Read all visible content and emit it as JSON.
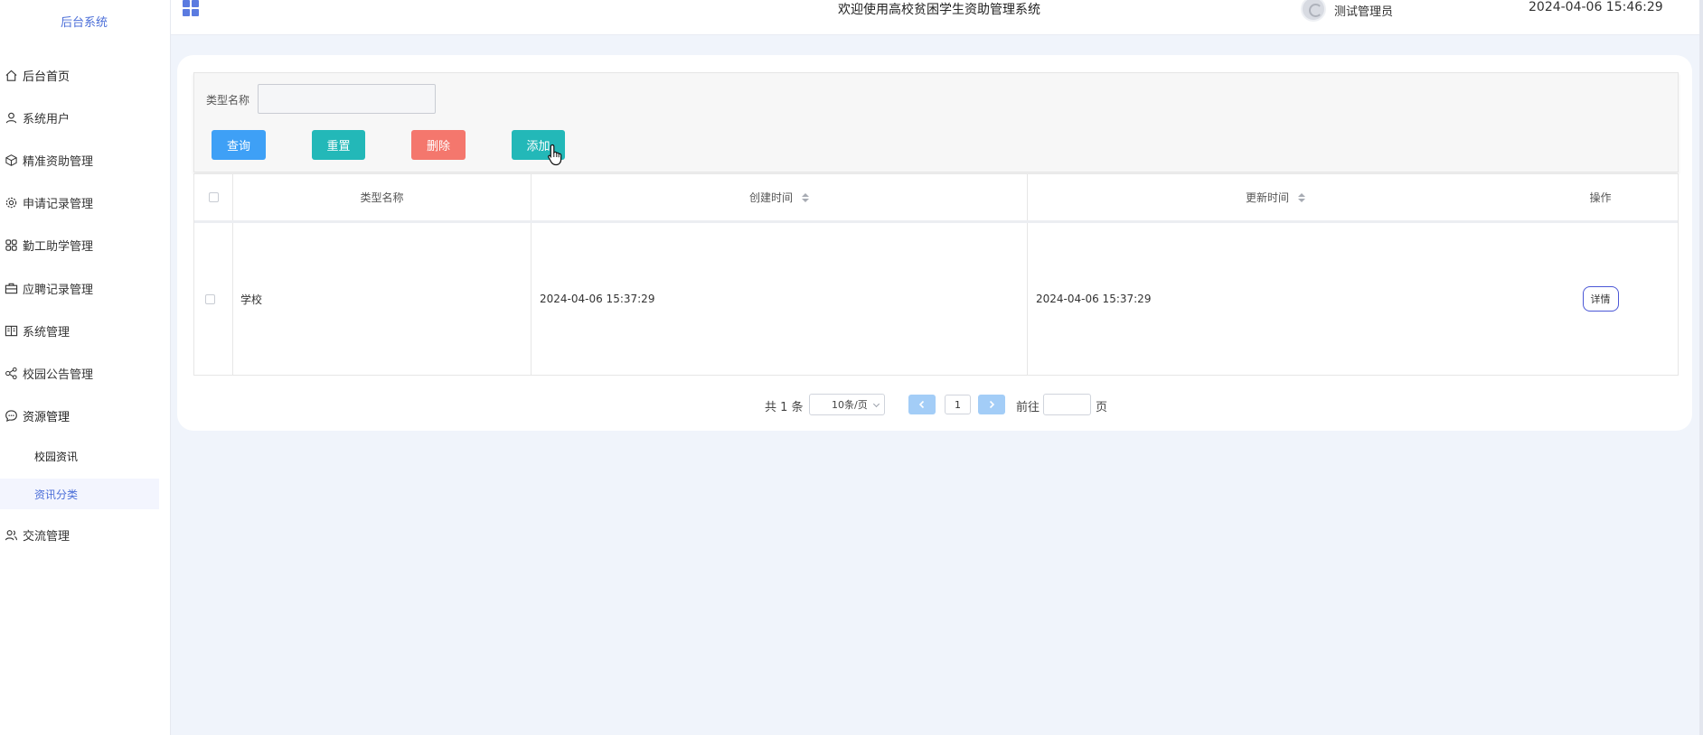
{
  "sidebar": {
    "brand": "后台系统",
    "items": [
      {
        "label": "后台首页",
        "icon": "home-icon"
      },
      {
        "label": "系统用户",
        "icon": "user-icon"
      },
      {
        "label": "精准资助管理",
        "icon": "cube-icon"
      },
      {
        "label": "申请记录管理",
        "icon": "gear-icon"
      },
      {
        "label": "勤工助学管理",
        "icon": "apps-icon"
      },
      {
        "label": "应聘记录管理",
        "icon": "briefcase-icon"
      },
      {
        "label": "系统管理",
        "icon": "book-icon"
      },
      {
        "label": "校园公告管理",
        "icon": "share-icon"
      },
      {
        "label": "资源管理",
        "icon": "chat-icon"
      },
      {
        "label": "交流管理",
        "icon": "users-icon"
      }
    ],
    "subitems": [
      {
        "label": "校园资讯"
      },
      {
        "label": "资讯分类"
      }
    ]
  },
  "topbar": {
    "welcome": "欢迎使用高校贫困学生资助管理系统",
    "username": "测试管理员",
    "datetime": "2024-04-06 15:46:29"
  },
  "search": {
    "label": "类型名称",
    "value": "",
    "placeholder": ""
  },
  "buttons": {
    "query": "查询",
    "reset": "重置",
    "delete": "删除",
    "add": "添加"
  },
  "table": {
    "columns": [
      "类型名称",
      "创建时间",
      "更新时间",
      "操作"
    ],
    "rows": [
      {
        "name": "学校",
        "created": "2024-04-06 15:37:29",
        "updated": "2024-04-06 15:37:29",
        "action": "详情"
      }
    ]
  },
  "pagination": {
    "total": "共 1 条",
    "page_size": "10条/页",
    "current_page": "1",
    "goto_label": "前往",
    "page_unit": "页"
  },
  "colors": {
    "primary": "#3ea0f6",
    "teal": "#23b8b8",
    "danger": "#f4776d",
    "accent": "#4b6ed8"
  }
}
